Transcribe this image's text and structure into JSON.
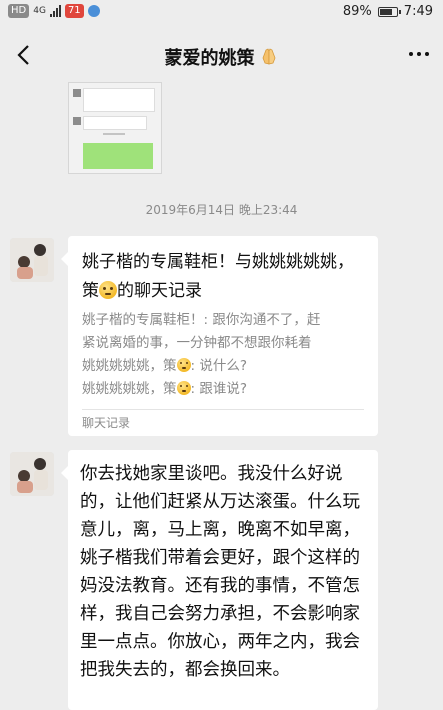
{
  "status_bar": {
    "chip_hd": "HD",
    "network": "4G",
    "chip_app": "71",
    "battery": "89%",
    "battery_level": 0.89,
    "time": "7:49"
  },
  "nav": {
    "title": "蒙爱的姚策"
  },
  "timestamp": "2019年6月14日 晚上23:44",
  "chat_record": {
    "title_before": "姚子楷的专属鞋柜！与姚姚姚姚姚，策",
    "title_after": "的聊天记录",
    "preview_line1": "姚子楷的专属鞋柜！: 跟你沟通不了，赶",
    "preview_line2": "紧说离婚的事，一分钟都不想跟你耗着",
    "preview_line3_before": "姚姚姚姚姚，策",
    "preview_line3_after": ": 说什么?",
    "preview_line4_before": "姚姚姚姚姚，策",
    "preview_line4_after": ": 跟谁说?",
    "footer": "聊天记录"
  },
  "message": {
    "text": "你去找她家里谈吧。我没什么好说的，让他们赶紧从万达滚蛋。什么玩意儿，离，马上离，晚离不如早离，姚子楷我们带着会更好，跟个这样的妈没法教育。还有我的事情，不管怎样，我自己会努力承担，不会影响家里一点点。你放心，两年之内，我会把我失去的，都会换回来。"
  },
  "colors": {
    "background": "#ededed",
    "bubble": "#ffffff",
    "muted_text": "#8a8a8a",
    "green_bubble": "#9fe27a"
  }
}
